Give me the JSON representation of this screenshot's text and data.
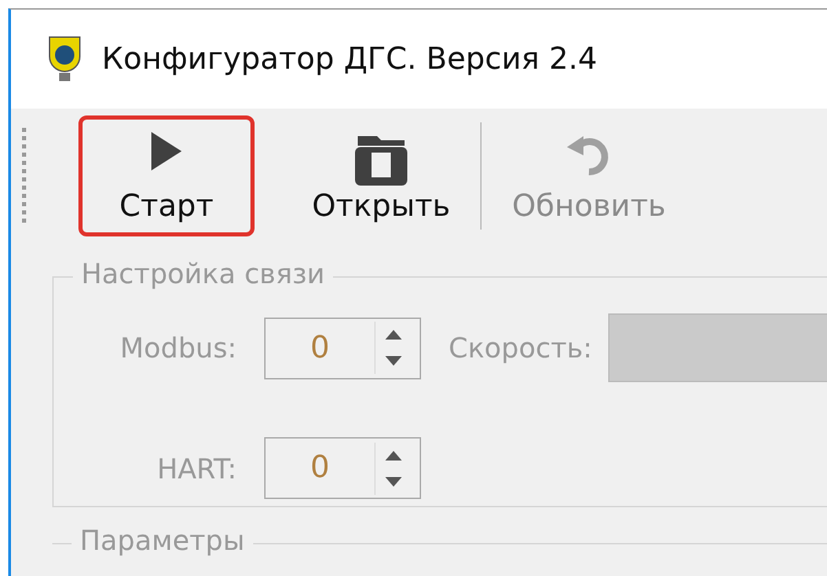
{
  "window": {
    "title": "Конфигуратор ДГС. Версия 2.4"
  },
  "toolbar": [
    {
      "kind": "play",
      "label": "Старт",
      "highlighted": true,
      "disabled": false
    },
    {
      "kind": "folder",
      "label": "Открыть",
      "highlighted": false,
      "disabled": false
    },
    {
      "kind": "refresh",
      "label": "Обновить",
      "highlighted": false,
      "disabled": true
    }
  ],
  "connection": {
    "legend": "Настройка связи",
    "disabled": true,
    "modbus": {
      "label": "Modbus:",
      "value": "0"
    },
    "speed": {
      "label": "Скорость:"
    },
    "hart": {
      "label": "HART:",
      "value": "0"
    }
  },
  "parameters": {
    "legend": "Параметры"
  }
}
